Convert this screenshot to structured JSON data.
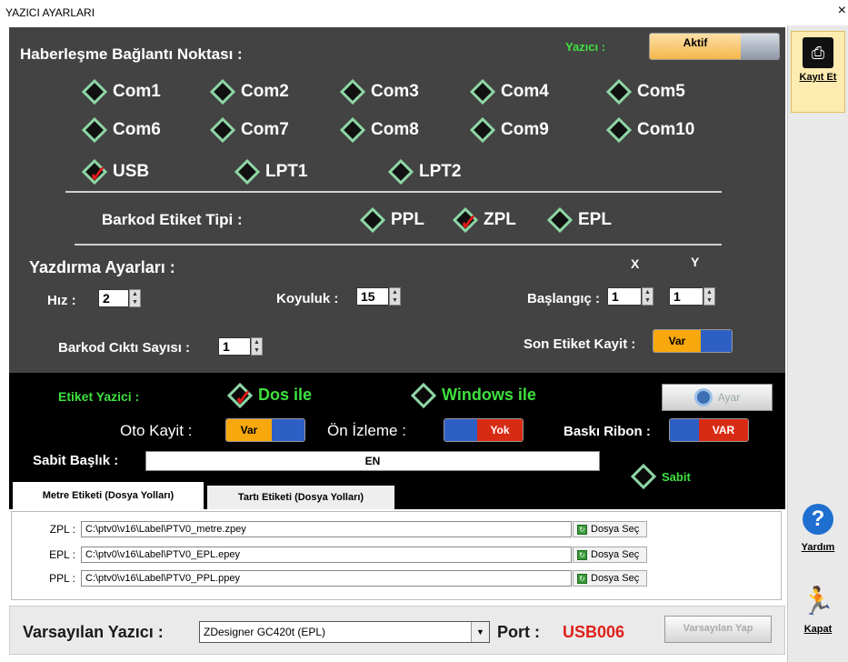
{
  "window": {
    "title": "YAZICI AYARLARI",
    "close": "×"
  },
  "main": {
    "comm_heading": "Haberleşme Bağlantı Noktası :",
    "printer_label": "Yazıcı :",
    "printer_toggle": "Aktif",
    "ports": [
      "Com1",
      "Com2",
      "Com3",
      "Com4",
      "Com5",
      "Com6",
      "Com7",
      "Com8",
      "Com9",
      "Com10",
      "USB",
      "LPT1",
      "LPT2"
    ],
    "barcode_type_label": "Barkod Etiket Tipi :",
    "barcode_types": [
      "PPL",
      "ZPL",
      "EPL"
    ],
    "print_settings": "Yazdırma Ayarları :",
    "x_label": "X",
    "y_label": "Y",
    "speed_label": "Hız :",
    "speed": "2",
    "darkness_label": "Koyuluk :",
    "darkness": "15",
    "start_label": "Başlangıç :",
    "start_x": "1",
    "start_y": "1",
    "count_label": "Barkod Cıktı Sayısı :",
    "count": "1",
    "last_label": "Son Etiket Kayit :",
    "last_toggle": "Var"
  },
  "black": {
    "label_printer": "Etiket Yazici :",
    "dos": "Dos ile",
    "windows": "Windows ile",
    "ayar": "Ayar",
    "auto_save": "Oto Kayit :",
    "auto_save_toggle": "Var",
    "preview": "Ön İzleme :",
    "preview_toggle": "Yok",
    "ribbon": "Baskı Ribon :",
    "ribbon_toggle": "VAR",
    "fixed_title": "Sabit Başlık :",
    "fixed_value": "EN",
    "fixed": "Sabit"
  },
  "tabs": [
    "Metre Etiketi (Dosya Yolları)",
    "Tartı Etiketi (Dosya Yolları)"
  ],
  "files": [
    {
      "label": "ZPL :",
      "path": "C:\\ptv0\\v16\\Label\\PTV0_metre.zpey",
      "button": "Dosya Seç"
    },
    {
      "label": "EPL :",
      "path": "C:\\ptv0\\v16\\Label\\PTV0_EPL.epey",
      "button": "Dosya Seç"
    },
    {
      "label": "PPL :",
      "path": "C:\\ptv0\\v16\\Label\\PTV0_PPL.ppey",
      "button": "Dosya Seç"
    }
  ],
  "bottom": {
    "default_label": "Varsayılan Yazıcı :",
    "printer": "ZDesigner GC420t (EPL)",
    "port_label": "Port :",
    "port": "USB006",
    "default_button": "Varsayılan Yap"
  },
  "sidebar": {
    "save": "Kayıt Et",
    "help": "Yardım",
    "close": "Kapat"
  }
}
